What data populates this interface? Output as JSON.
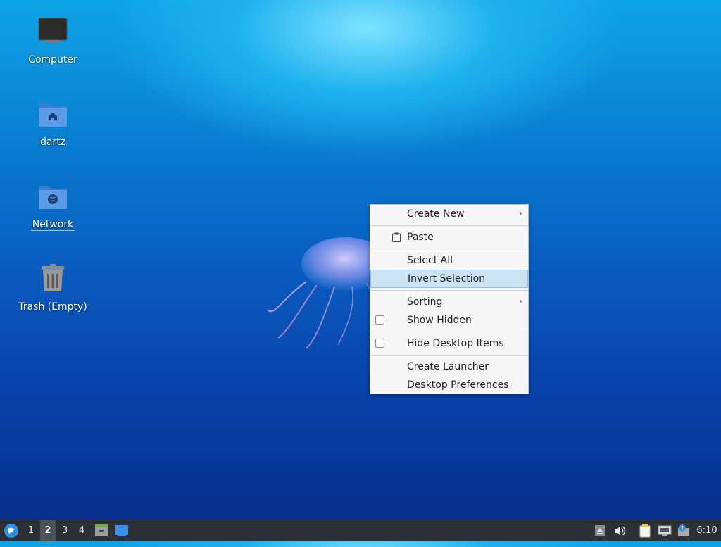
{
  "desktop": {
    "icons": [
      {
        "label": "Computer",
        "icon": "monitor-icon"
      },
      {
        "label": "dartz",
        "icon": "home-folder-icon"
      },
      {
        "label": "Network",
        "icon": "network-folder-icon"
      },
      {
        "label": "Trash (Empty)",
        "icon": "trash-icon"
      }
    ]
  },
  "context_menu": {
    "items": [
      {
        "label": "Create New",
        "submenu": true
      },
      {
        "label": "Paste",
        "icon": "paste-icon"
      },
      {
        "label": "Select All"
      },
      {
        "label": "Invert Selection",
        "highlighted": true
      },
      {
        "label": "Sorting",
        "submenu": true
      },
      {
        "label": "Show Hidden",
        "checkbox": true,
        "checked": false
      },
      {
        "label": "Hide Desktop Items",
        "checkbox": true,
        "checked": false
      },
      {
        "label": "Create Launcher"
      },
      {
        "label": "Desktop Preferences"
      }
    ],
    "submenu_glyph": "›"
  },
  "taskbar": {
    "workspaces": [
      "1",
      "2",
      "3",
      "4"
    ],
    "active_workspace": "2",
    "clock": "6:10"
  },
  "colors": {
    "menu_highlight": "#cbe3f2",
    "taskbar_bg": "#2d3136"
  }
}
